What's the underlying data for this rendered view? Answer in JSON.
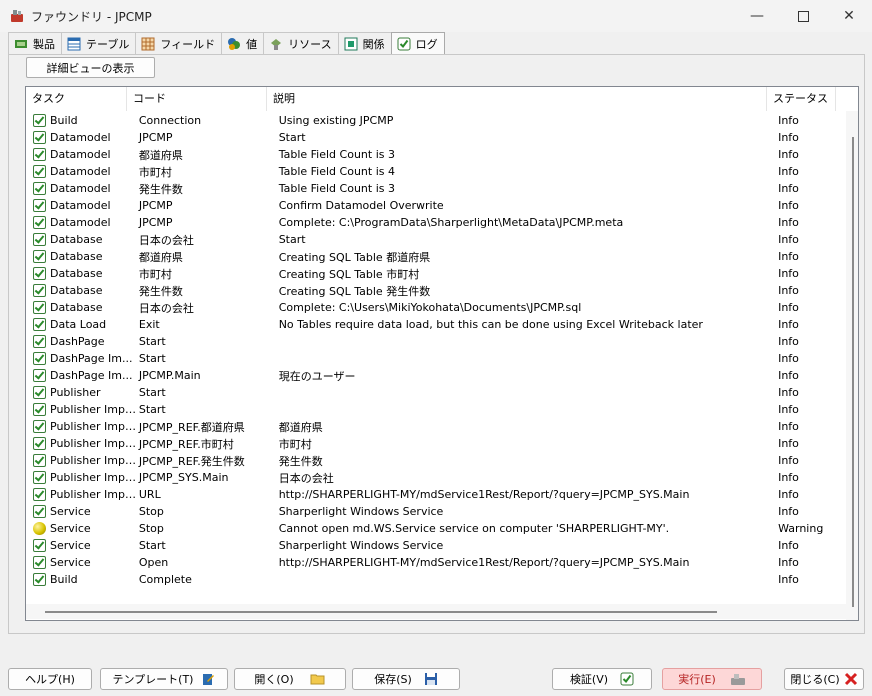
{
  "window": {
    "title": "ファウンドリ - JPCMP"
  },
  "tabs": [
    {
      "label": "製品",
      "icon": "product-icon"
    },
    {
      "label": "テーブル",
      "icon": "table-icon"
    },
    {
      "label": "フィールド",
      "icon": "field-icon"
    },
    {
      "label": "値",
      "icon": "value-icon"
    },
    {
      "label": "リソース",
      "icon": "resource-icon"
    },
    {
      "label": "関係",
      "icon": "relation-icon"
    },
    {
      "label": "ログ",
      "icon": "log-icon"
    }
  ],
  "toolbar": {
    "detail_view_label": "詳細ビューの表示"
  },
  "log": {
    "columns": [
      "タスク",
      "コード",
      "説明",
      "ステータス"
    ],
    "rows": [
      {
        "task": "Build",
        "code": "Connection",
        "desc": "Using existing JPCMP",
        "status": "Info",
        "icon": "check"
      },
      {
        "task": "Datamodel",
        "code": "JPCMP",
        "desc": "Start",
        "status": "Info",
        "icon": "check"
      },
      {
        "task": "Datamodel",
        "code": "都道府県",
        "desc": "Table Field Count is 3",
        "status": "Info",
        "icon": "check"
      },
      {
        "task": "Datamodel",
        "code": "市町村",
        "desc": "Table Field Count is 4",
        "status": "Info",
        "icon": "check"
      },
      {
        "task": "Datamodel",
        "code": "発生件数",
        "desc": "Table Field Count is 3",
        "status": "Info",
        "icon": "check"
      },
      {
        "task": "Datamodel",
        "code": "JPCMP",
        "desc": "Confirm Datamodel Overwrite",
        "status": "Info",
        "icon": "check"
      },
      {
        "task": "Datamodel",
        "code": "JPCMP",
        "desc": "Complete: C:\\ProgramData\\Sharperlight\\MetaData\\JPCMP.meta",
        "status": "Info",
        "icon": "check"
      },
      {
        "task": "Database",
        "code": "日本の会社",
        "desc": "Start",
        "status": "Info",
        "icon": "check"
      },
      {
        "task": "Database",
        "code": "都道府県",
        "desc": "Creating SQL Table 都道府県",
        "status": "Info",
        "icon": "check"
      },
      {
        "task": "Database",
        "code": "市町村",
        "desc": "Creating SQL Table 市町村",
        "status": "Info",
        "icon": "check"
      },
      {
        "task": "Database",
        "code": "発生件数",
        "desc": "Creating SQL Table 発生件数",
        "status": "Info",
        "icon": "check"
      },
      {
        "task": "Database",
        "code": "日本の会社",
        "desc": "Complete: C:\\Users\\MikiYokohata\\Documents\\JPCMP.sql",
        "status": "Info",
        "icon": "check"
      },
      {
        "task": "Data Load",
        "code": "Exit",
        "desc": "No Tables require data load, but this can be done using Excel Writeback later",
        "status": "Info",
        "icon": "check"
      },
      {
        "task": "DashPage",
        "code": "Start",
        "desc": "",
        "status": "Info",
        "icon": "check"
      },
      {
        "task": "DashPage Im...",
        "code": "Start",
        "desc": "",
        "status": "Info",
        "icon": "check"
      },
      {
        "task": "DashPage Im...",
        "code": "JPCMP.Main",
        "desc": "現在のユーザー",
        "status": "Info",
        "icon": "check"
      },
      {
        "task": "Publisher",
        "code": "Start",
        "desc": "",
        "status": "Info",
        "icon": "check"
      },
      {
        "task": "Publisher Import",
        "code": "Start",
        "desc": "",
        "status": "Info",
        "icon": "check"
      },
      {
        "task": "Publisher Import",
        "code": "JPCMP_REF.都道府県",
        "desc": "都道府県",
        "status": "Info",
        "icon": "check"
      },
      {
        "task": "Publisher Import",
        "code": "JPCMP_REF.市町村",
        "desc": "市町村",
        "status": "Info",
        "icon": "check"
      },
      {
        "task": "Publisher Import",
        "code": "JPCMP_REF.発生件数",
        "desc": "発生件数",
        "status": "Info",
        "icon": "check"
      },
      {
        "task": "Publisher Import",
        "code": "JPCMP_SYS.Main",
        "desc": "日本の会社",
        "status": "Info",
        "icon": "check"
      },
      {
        "task": "Publisher Import",
        "code": "URL",
        "desc": "http://SHARPERLIGHT-MY/mdService1Rest/Report/?query=JPCMP_SYS.Main",
        "status": "Info",
        "icon": "check"
      },
      {
        "task": "Service",
        "code": "Stop",
        "desc": "Sharperlight Windows Service",
        "status": "Info",
        "icon": "check"
      },
      {
        "task": "Service",
        "code": "Stop",
        "desc": "Cannot open md.WS.Service service on computer 'SHARPERLIGHT-MY'.",
        "status": "Warning",
        "icon": "warning"
      },
      {
        "task": "Service",
        "code": "Start",
        "desc": "Sharperlight Windows Service",
        "status": "Info",
        "icon": "check"
      },
      {
        "task": "Service",
        "code": "Open",
        "desc": "http://SHARPERLIGHT-MY/mdService1Rest/Report/?query=JPCMP_SYS.Main",
        "status": "Info",
        "icon": "check"
      },
      {
        "task": "Build",
        "code": "Complete",
        "desc": "",
        "status": "Info",
        "icon": "check"
      }
    ]
  },
  "buttons": {
    "help": "ヘルプ(H)",
    "template": "テンプレート(T)",
    "open": "開く(O)",
    "save": "保存(S)",
    "verify": "検証(V)",
    "run": "実行(E)",
    "close": "閉じる(C)"
  }
}
